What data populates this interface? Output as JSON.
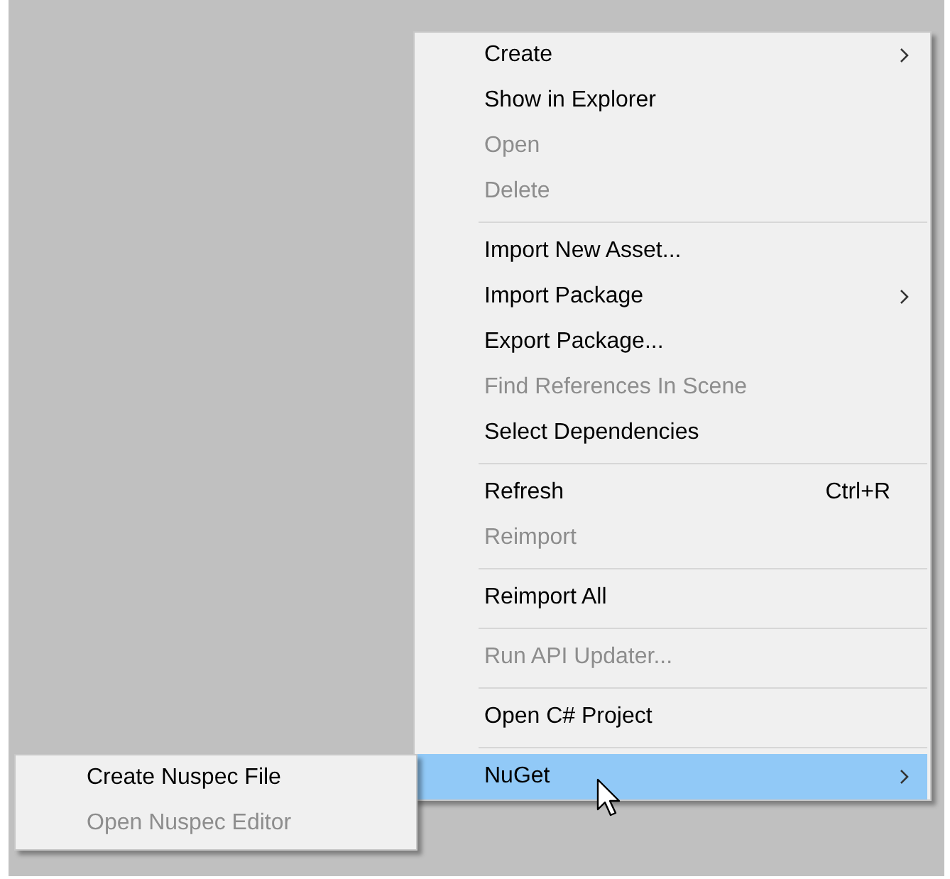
{
  "context_menu": {
    "groups": [
      [
        {
          "label": "Create",
          "disabled": false,
          "has_submenu": true,
          "selected": false
        },
        {
          "label": "Show in Explorer",
          "disabled": false,
          "has_submenu": false,
          "selected": false
        },
        {
          "label": "Open",
          "disabled": true,
          "has_submenu": false,
          "selected": false
        },
        {
          "label": "Delete",
          "disabled": true,
          "has_submenu": false,
          "selected": false
        }
      ],
      [
        {
          "label": "Import New Asset...",
          "disabled": false,
          "has_submenu": false,
          "selected": false
        },
        {
          "label": "Import Package",
          "disabled": false,
          "has_submenu": true,
          "selected": false
        },
        {
          "label": "Export Package...",
          "disabled": false,
          "has_submenu": false,
          "selected": false
        },
        {
          "label": "Find References In Scene",
          "disabled": true,
          "has_submenu": false,
          "selected": false
        },
        {
          "label": "Select Dependencies",
          "disabled": false,
          "has_submenu": false,
          "selected": false
        }
      ],
      [
        {
          "label": "Refresh",
          "shortcut": "Ctrl+R",
          "disabled": false,
          "has_submenu": false,
          "selected": false
        },
        {
          "label": "Reimport",
          "disabled": true,
          "has_submenu": false,
          "selected": false
        }
      ],
      [
        {
          "label": "Reimport All",
          "disabled": false,
          "has_submenu": false,
          "selected": false
        }
      ],
      [
        {
          "label": "Run API Updater...",
          "disabled": true,
          "has_submenu": false,
          "selected": false
        }
      ],
      [
        {
          "label": "Open C# Project",
          "disabled": false,
          "has_submenu": false,
          "selected": false
        }
      ],
      [
        {
          "label": "NuGet",
          "disabled": false,
          "has_submenu": true,
          "selected": true
        }
      ]
    ]
  },
  "submenu": {
    "items": [
      {
        "label": "Create Nuspec File",
        "disabled": false,
        "selected": false
      },
      {
        "label": "Open Nuspec Editor",
        "disabled": true,
        "selected": false
      }
    ]
  }
}
